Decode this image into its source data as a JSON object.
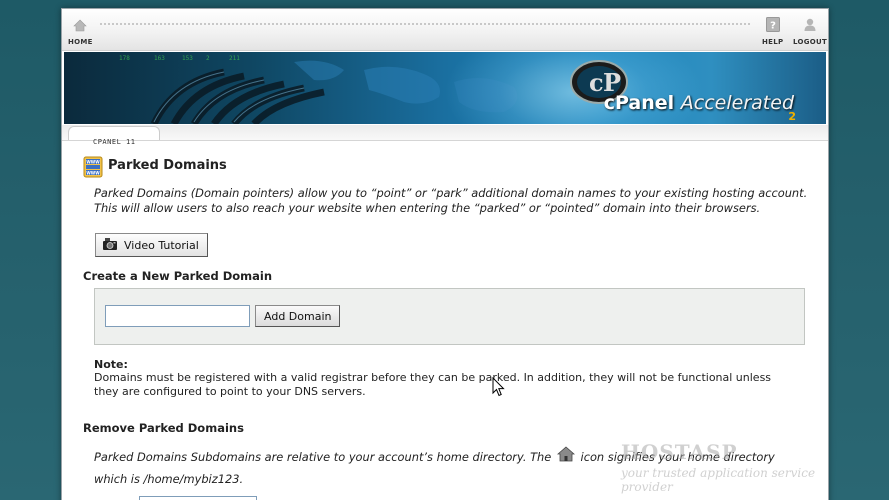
{
  "nav": {
    "home_label": "HOME",
    "help_label": "HELP",
    "logout_label": "LOGOUT"
  },
  "banner": {
    "brand": "cPanel",
    "product": "Accelerated",
    "version_sub": "2"
  },
  "version_tab": "CPANEL 11",
  "page": {
    "title": "Parked Domains",
    "description_line1": "Parked Domains (Domain pointers) allow you to “point” or “park” additional domain names to your existing hosting account.",
    "description_line2": "This will allow users to also reach your website when entering the “parked” or “pointed” domain into their browsers.",
    "video_button": "Video Tutorial"
  },
  "create_section": {
    "heading": "Create a New Parked Domain",
    "input_value": "",
    "add_button": "Add Domain"
  },
  "note": {
    "heading": "Note:",
    "line1": "Domains must be registered with a valid registrar before they can be parked. In addition, they will not be functional unless",
    "line2": "they are configured to point to your DNS servers."
  },
  "remove_section": {
    "heading": "Remove Parked Domains",
    "desc_before_icon": "Parked Domains Subdomains are relative to your account’s home directory. The",
    "desc_after_icon": "icon signifies your home directory",
    "desc_line2": "which is /home/mybiz123."
  },
  "watermark": {
    "brand": "HOSTASP",
    "tagline": "your trusted application service provider"
  },
  "colors": {
    "background": "#245f6b",
    "banner_accent": "#1d86bd"
  }
}
